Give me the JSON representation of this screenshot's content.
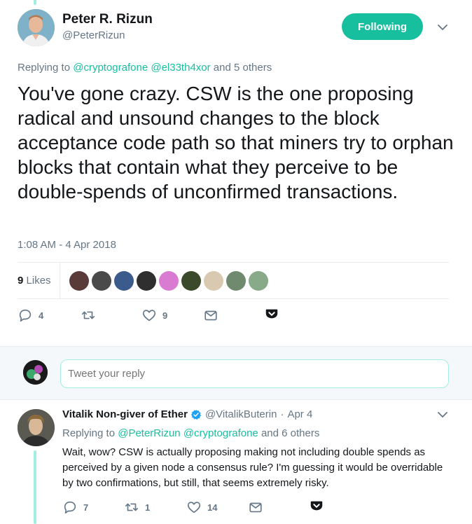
{
  "main_tweet": {
    "author_name": "Peter R. Rizun",
    "author_handle": "@PeterRizun",
    "follow_label": "Following",
    "replying_prefix": "Replying to",
    "replying_mentions": [
      "@cryptografone",
      "@el33th4xor"
    ],
    "replying_suffix": "and 5 others",
    "text": "You've gone crazy.  CSW is the one proposing radical and unsound changes to the block acceptance code path so that miners try to orphan blocks that contain what they perceive to be double-spends of unconfirmed transactions.",
    "timestamp": "1:08 AM - 4 Apr 2018",
    "likes_number": "9",
    "likes_label": "Likes",
    "likers": [
      {
        "icon": "avatar",
        "color": "#5b3a3a"
      },
      {
        "icon": "avatar",
        "color": "#4a4a4a"
      },
      {
        "icon": "avatar",
        "color": "#3b5b8c"
      },
      {
        "icon": "avatar",
        "color": "#2f2f2f"
      },
      {
        "icon": "avatar",
        "color": "#d97bd0"
      },
      {
        "icon": "avatar",
        "color": "#3a4a2a"
      },
      {
        "icon": "avatar",
        "color": "#d9c9b0"
      },
      {
        "icon": "avatar",
        "color": "#6f8a6f"
      },
      {
        "icon": "avatar",
        "color": "#88aa88"
      }
    ],
    "actions": {
      "reply_count": "4",
      "retweet_count": "",
      "like_count": "9"
    }
  },
  "reply_box": {
    "placeholder": "Tweet your reply"
  },
  "second_tweet": {
    "author_name": "Vitalik Non-giver of Ether",
    "author_handle": "@VitalikButerin",
    "separator": "·",
    "date": "Apr 4",
    "replying_prefix": "Replying to",
    "replying_mentions": [
      "@PeterRizun",
      "@cryptografone"
    ],
    "replying_suffix": "and 6 others",
    "text": "Wait, wow? CSW is actually proposing making not including double spends as perceived by a given node a consensus rule? I'm guessing it would be overridable by two confirmations, but still, that seems extremely risky.",
    "actions": {
      "reply_count": "7",
      "retweet_count": "1",
      "like_count": "14"
    }
  },
  "colors": {
    "accent": "#17bf9f",
    "muted": "#657786",
    "text": "#14171a",
    "thread_line": "#a3eee0",
    "divider": "#e6ecf0"
  }
}
